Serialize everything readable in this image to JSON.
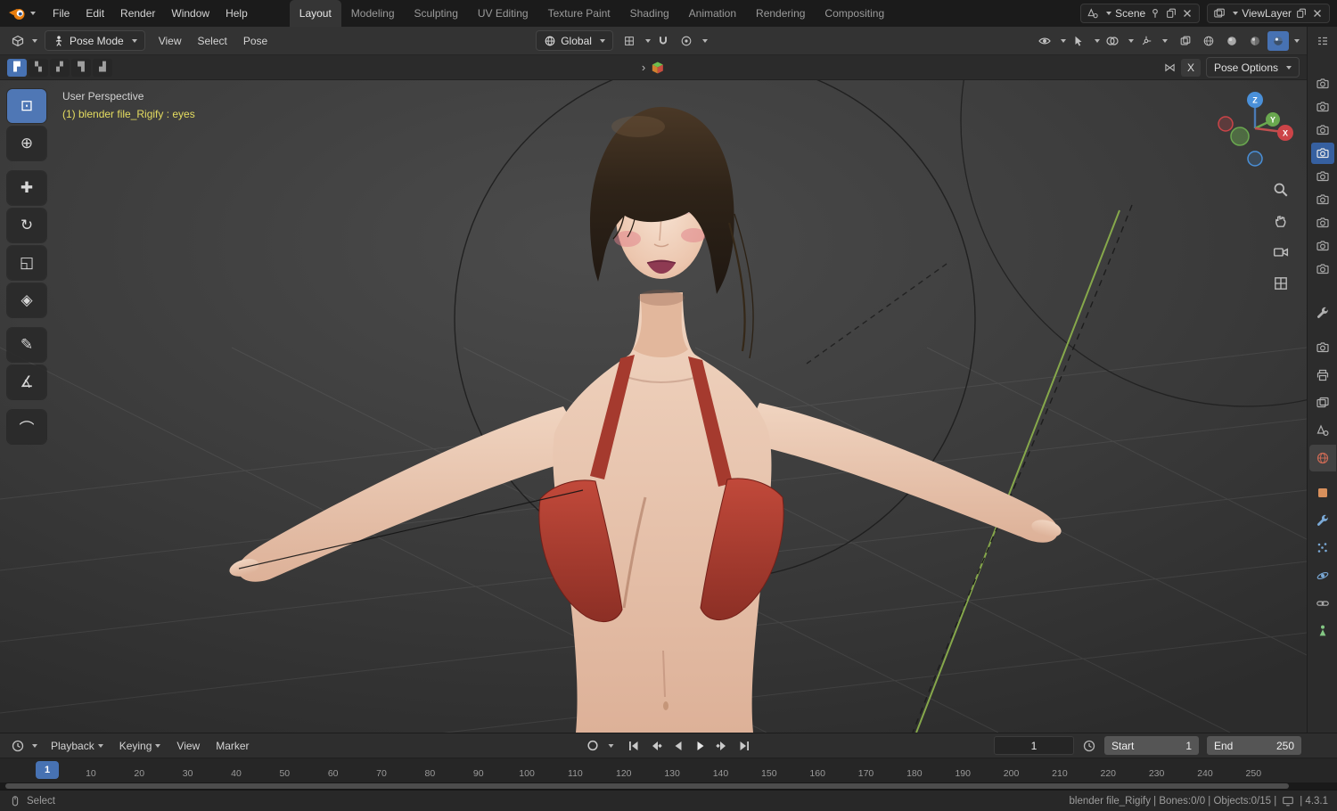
{
  "colors": {
    "accent": "#4772b3",
    "overlay_text_yellow": "#e5dd60",
    "bra_red": "#b23b31",
    "skin": "#ecc9b2",
    "hair": "#2e2318",
    "axis_x": "#c94b4b",
    "axis_y": "#6fae4d",
    "axis_z": "#4a90d9"
  },
  "topbar": {
    "app_menus": [
      "File",
      "Edit",
      "Render",
      "Window",
      "Help"
    ],
    "workspaces": [
      {
        "label": "Layout",
        "active": true
      },
      {
        "label": "Modeling"
      },
      {
        "label": "Sculpting"
      },
      {
        "label": "UV Editing"
      },
      {
        "label": "Texture Paint"
      },
      {
        "label": "Shading"
      },
      {
        "label": "Animation"
      },
      {
        "label": "Rendering"
      },
      {
        "label": "Compositing"
      }
    ],
    "scene_label": "Scene",
    "viewlayer_label": "ViewLayer"
  },
  "viewport_header": {
    "mode": "Pose Mode",
    "menus": [
      "View",
      "Select",
      "Pose"
    ],
    "orientation": "Global"
  },
  "tool_header": {
    "select_modes": [
      {
        "name": "new",
        "glyph": "▛",
        "active": true
      },
      {
        "name": "extend",
        "glyph": "▚"
      },
      {
        "name": "subtract",
        "glyph": "▞"
      },
      {
        "name": "invert",
        "glyph": "▜"
      },
      {
        "name": "intersect",
        "glyph": "▟"
      }
    ],
    "breadcrumb_arrow": "›",
    "mirror_x": "X",
    "pose_options": "Pose Options"
  },
  "toolbar": {
    "tools": [
      {
        "name": "select-box",
        "glyph": "⊡",
        "active": true
      },
      {
        "name": "cursor",
        "glyph": "⊕"
      },
      {
        "name": "move",
        "glyph": "✚",
        "gap": true
      },
      {
        "name": "rotate",
        "glyph": "↻"
      },
      {
        "name": "scale",
        "glyph": "◱"
      },
      {
        "name": "transform",
        "glyph": "◈"
      },
      {
        "name": "annotate",
        "glyph": "✎",
        "gap": true
      },
      {
        "name": "measure",
        "glyph": "∡"
      },
      {
        "name": "add-curve",
        "glyph": "⌒",
        "gap": true
      }
    ]
  },
  "viewport": {
    "overlay_title": "User Perspective",
    "overlay_subtitle": "(1) blender file_Rigify : eyes",
    "gizmo_axes": [
      "Z",
      "Y",
      "X"
    ]
  },
  "right_rail": {
    "outliner_items": [
      {
        "icon": "camera"
      },
      {
        "icon": "camera"
      },
      {
        "icon": "camera"
      },
      {
        "icon": "camera",
        "active": true
      },
      {
        "icon": "camera"
      },
      {
        "icon": "camera"
      },
      {
        "icon": "camera"
      },
      {
        "icon": "camera"
      },
      {
        "icon": "camera"
      }
    ],
    "properties_tabs": [
      {
        "name": "tool",
        "icon": "wrench",
        "color": "#b0b0b0"
      },
      {
        "name": "render",
        "icon": "camera",
        "color": "#b0b0b0",
        "gap": true
      },
      {
        "name": "output",
        "icon": "printer",
        "color": "#b0b0b0"
      },
      {
        "name": "view-layer",
        "icon": "images",
        "color": "#b0b0b0"
      },
      {
        "name": "scene",
        "icon": "scene",
        "color": "#b0b0b0"
      },
      {
        "name": "world",
        "icon": "globe",
        "color": "#cc6a55",
        "active": true
      },
      {
        "name": "object",
        "icon": "cube",
        "color": "#d8905c",
        "gap": true
      },
      {
        "name": "modifiers",
        "icon": "wrench",
        "color": "#7aa9d6"
      },
      {
        "name": "particles",
        "icon": "dots",
        "color": "#7aa9d6"
      },
      {
        "name": "physics",
        "icon": "orbit",
        "color": "#7aa9d6"
      },
      {
        "name": "constraints",
        "icon": "links",
        "color": "#b0b0b0"
      },
      {
        "name": "data",
        "icon": "person",
        "color": "#84c884"
      }
    ]
  },
  "timeline": {
    "menus": [
      {
        "label": "Playback",
        "caret": true
      },
      {
        "label": "Keying",
        "caret": true
      },
      {
        "label": "View"
      },
      {
        "label": "Marker"
      }
    ],
    "transport": [
      "jump-to-start",
      "jump-to-prev-keyframe",
      "play-reverse",
      "play",
      "jump-to-next-keyframe",
      "jump-to-end"
    ],
    "current_frame": "1",
    "start_label": "Start",
    "start_value": "1",
    "end_label": "End",
    "end_value": "250",
    "ruler_frames": [
      1,
      10,
      20,
      30,
      40,
      50,
      60,
      70,
      80,
      90,
      100,
      110,
      120,
      130,
      140,
      150,
      160,
      170,
      180,
      190,
      200,
      210,
      220,
      230,
      240,
      250
    ]
  },
  "statusbar": {
    "left": "Select",
    "right_info": "blender file_Rigify | Bones:0/0 | Objects:0/15 |",
    "version": "| 4.3.1"
  }
}
